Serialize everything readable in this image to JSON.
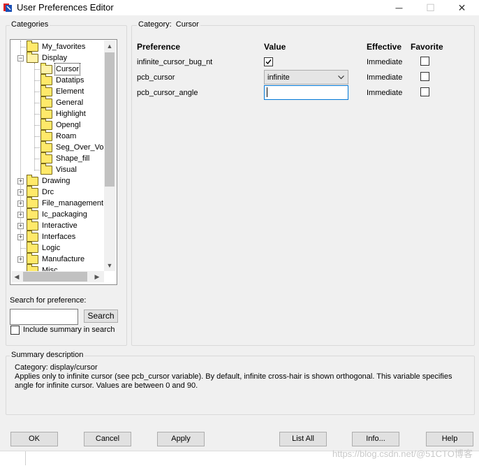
{
  "window": {
    "title": "User Preferences Editor",
    "minimize_glyph": "─",
    "maximize_glyph": "☐",
    "close_glyph": "✕",
    "app_icon": "editor-app-icon"
  },
  "categories": {
    "label": "Categories",
    "items": [
      {
        "label": "My_favorites"
      },
      {
        "label": "Display"
      },
      {
        "label": "Cursor"
      },
      {
        "label": "Datatips"
      },
      {
        "label": "Element"
      },
      {
        "label": "General"
      },
      {
        "label": "Highlight"
      },
      {
        "label": "Opengl"
      },
      {
        "label": "Roam"
      },
      {
        "label": "Seg_Over_Voi"
      },
      {
        "label": "Shape_fill"
      },
      {
        "label": "Visual"
      },
      {
        "label": "Drawing"
      },
      {
        "label": "Drc"
      },
      {
        "label": "File_management"
      },
      {
        "label": "Ic_packaging"
      },
      {
        "label": "Interactive"
      },
      {
        "label": "Interfaces"
      },
      {
        "label": "Logic"
      },
      {
        "label": "Manufacture"
      },
      {
        "label": "Misc"
      }
    ],
    "selected": "Cursor"
  },
  "search": {
    "label": "Search for preference:",
    "value": "",
    "button": "Search",
    "include_summary_label": "Include summary in search",
    "include_summary_checked": false
  },
  "category_header": {
    "label": "Category:",
    "value": "Cursor"
  },
  "columns": {
    "preference": "Preference",
    "value": "Value",
    "effective": "Effective",
    "favorite": "Favorite"
  },
  "preferences": [
    {
      "name": "infinite_cursor_bug_nt",
      "value_type": "checkbox",
      "checked": true,
      "effective": "Immediate",
      "favorite": false
    },
    {
      "name": "pcb_cursor",
      "value_type": "select",
      "value": "infinite",
      "effective": "Immediate",
      "favorite": false
    },
    {
      "name": "pcb_cursor_angle",
      "value_type": "text",
      "value": "",
      "effective": "Immediate",
      "favorite": false
    }
  ],
  "summary": {
    "label": "Summary description",
    "category_line": "Category: display/cursor",
    "text": "Applies only to infinite cursor (see pcb_cursor variable). By default, infinite cross-hair is shown orthogonal. This variable specifies angle for infinite cursor. Values are between 0  and 90."
  },
  "buttons": {
    "ok": "OK",
    "cancel": "Cancel",
    "apply": "Apply",
    "list_all": "List All",
    "info": "Info...",
    "help": "Help"
  },
  "watermark": "https://blog.csdn.net/@51CTO博客"
}
